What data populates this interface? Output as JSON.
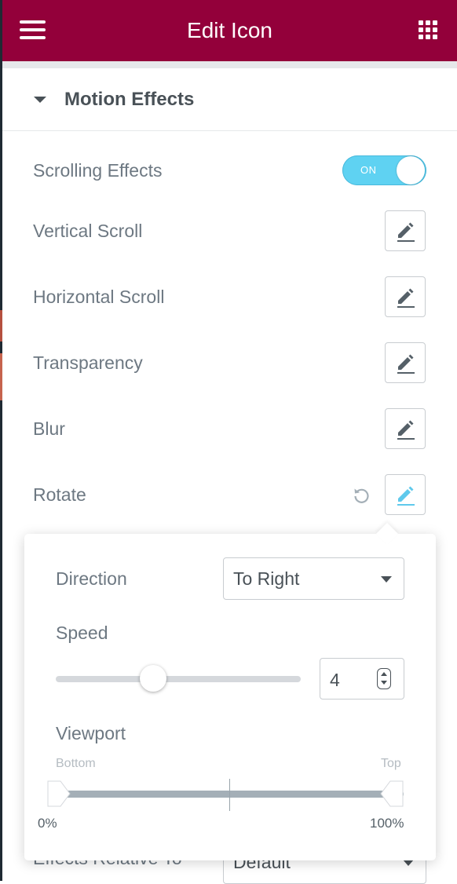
{
  "colors": {
    "header_bg": "#93003a",
    "toggle_on": "#5fd2f2",
    "active_edit": "#5fc9ec",
    "label_text": "#6d7882"
  },
  "header": {
    "title": "Edit Icon",
    "menu_icon": "hamburger-icon",
    "apps_icon": "grid-icon"
  },
  "section": {
    "title": "Motion Effects",
    "expanded": true
  },
  "controls": {
    "scrolling_effects": {
      "label": "Scrolling Effects",
      "toggle_text": "ON",
      "enabled": true
    },
    "effects": [
      {
        "label": "Vertical Scroll",
        "icon": "pencil-icon"
      },
      {
        "label": "Horizontal Scroll",
        "icon": "pencil-icon"
      },
      {
        "label": "Transparency",
        "icon": "pencil-icon"
      },
      {
        "label": "Blur",
        "icon": "pencil-icon"
      },
      {
        "label": "Rotate",
        "icon": "pencil-icon",
        "active": true,
        "reset_icon": "reset-icon"
      }
    ]
  },
  "rotate_popover": {
    "direction": {
      "label": "Direction",
      "value": "To Right"
    },
    "speed": {
      "label": "Speed",
      "value": "4",
      "slider_fraction": 0.4
    },
    "viewport": {
      "label": "Viewport",
      "start_label": "Bottom",
      "end_label": "Top",
      "start_value": "0%",
      "end_value": "100%"
    }
  },
  "effects_relative_to": {
    "label": "Effects Relative To",
    "value": "Default"
  }
}
